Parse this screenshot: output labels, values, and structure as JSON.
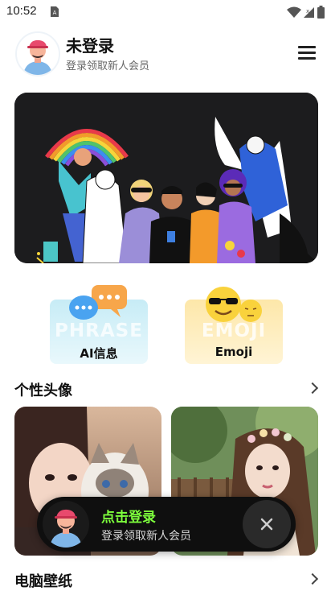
{
  "status_bar": {
    "time": "10:52",
    "icons": [
      "sim-card-icon",
      "wifi-icon",
      "signal-icon",
      "battery-icon"
    ]
  },
  "header": {
    "title": "未登录",
    "subtitle": "登录领取新人会员",
    "menu_icon": "hamburger-menu-icon"
  },
  "features": [
    {
      "label": "AI信息",
      "bg_text": "PHRASE",
      "icon": "chat-bubbles-icon"
    },
    {
      "label": "Emoji",
      "bg_text": "EMOJI",
      "icon": "emoji-faces-icon"
    }
  ],
  "sections": [
    {
      "title": "个性头像"
    },
    {
      "title": "电脑壁纸"
    }
  ],
  "login_toast": {
    "title": "点击登录",
    "subtitle": "登录领取新人会员",
    "close_icon": "close-icon"
  },
  "colors": {
    "accent_green": "#7dff3c",
    "toast_bg": "#0f0f0f",
    "banner_bg": "#1c1c1e",
    "ai_tile_bg": "#c7ecf6",
    "emoji_tile_bg": "#fde7a9"
  }
}
